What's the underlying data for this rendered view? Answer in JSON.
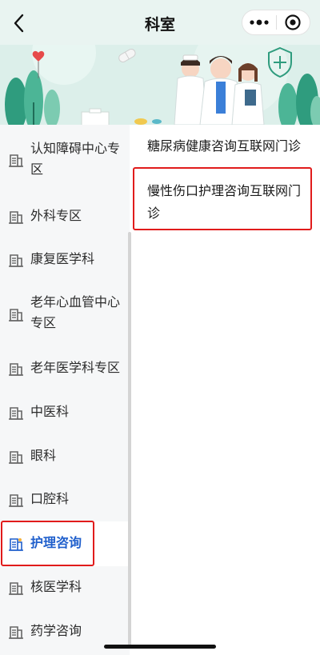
{
  "header": {
    "title": "科室"
  },
  "sidebar": {
    "items": [
      {
        "label": "认知障碍中心专区",
        "active": false
      },
      {
        "label": "外科专区",
        "active": false
      },
      {
        "label": "康复医学科",
        "active": false
      },
      {
        "label": "老年心血管中心专区",
        "active": false
      },
      {
        "label": "老年医学科专区",
        "active": false
      },
      {
        "label": "中医科",
        "active": false
      },
      {
        "label": "眼科",
        "active": false
      },
      {
        "label": "口腔科",
        "active": false
      },
      {
        "label": "护理咨询",
        "active": true
      },
      {
        "label": "核医学科",
        "active": false
      },
      {
        "label": "药学咨询",
        "active": false
      }
    ]
  },
  "main": {
    "clinics": [
      {
        "label": "糖尿病健康咨询互联网门诊"
      },
      {
        "label": "慢性伤口护理咨询互联网门诊"
      }
    ]
  },
  "colors": {
    "accent": "#1f5fcc",
    "highlight_box": "#e11b1b",
    "header_bg": "#e9f4f1"
  }
}
